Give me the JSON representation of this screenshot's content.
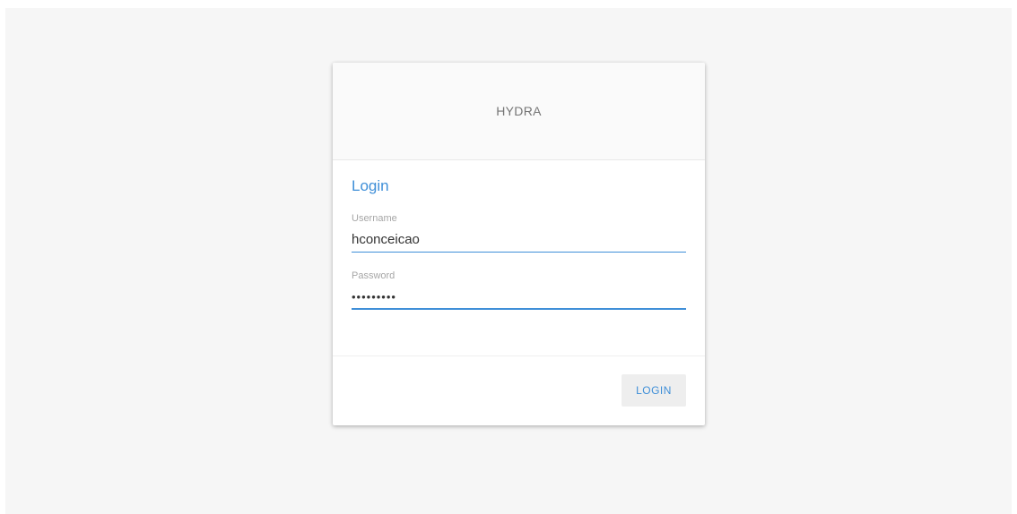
{
  "header": {
    "brand": "HYDRA"
  },
  "form": {
    "title": "Login",
    "username": {
      "label": "Username",
      "value": "hconceicao"
    },
    "password": {
      "label": "Password",
      "value": "•••••••••"
    },
    "login_button_label": "LOGIN"
  },
  "colors": {
    "accent": "#3f8fd8",
    "background": "#f6f6f6",
    "card": "#ffffff",
    "header": "#fafafa"
  }
}
